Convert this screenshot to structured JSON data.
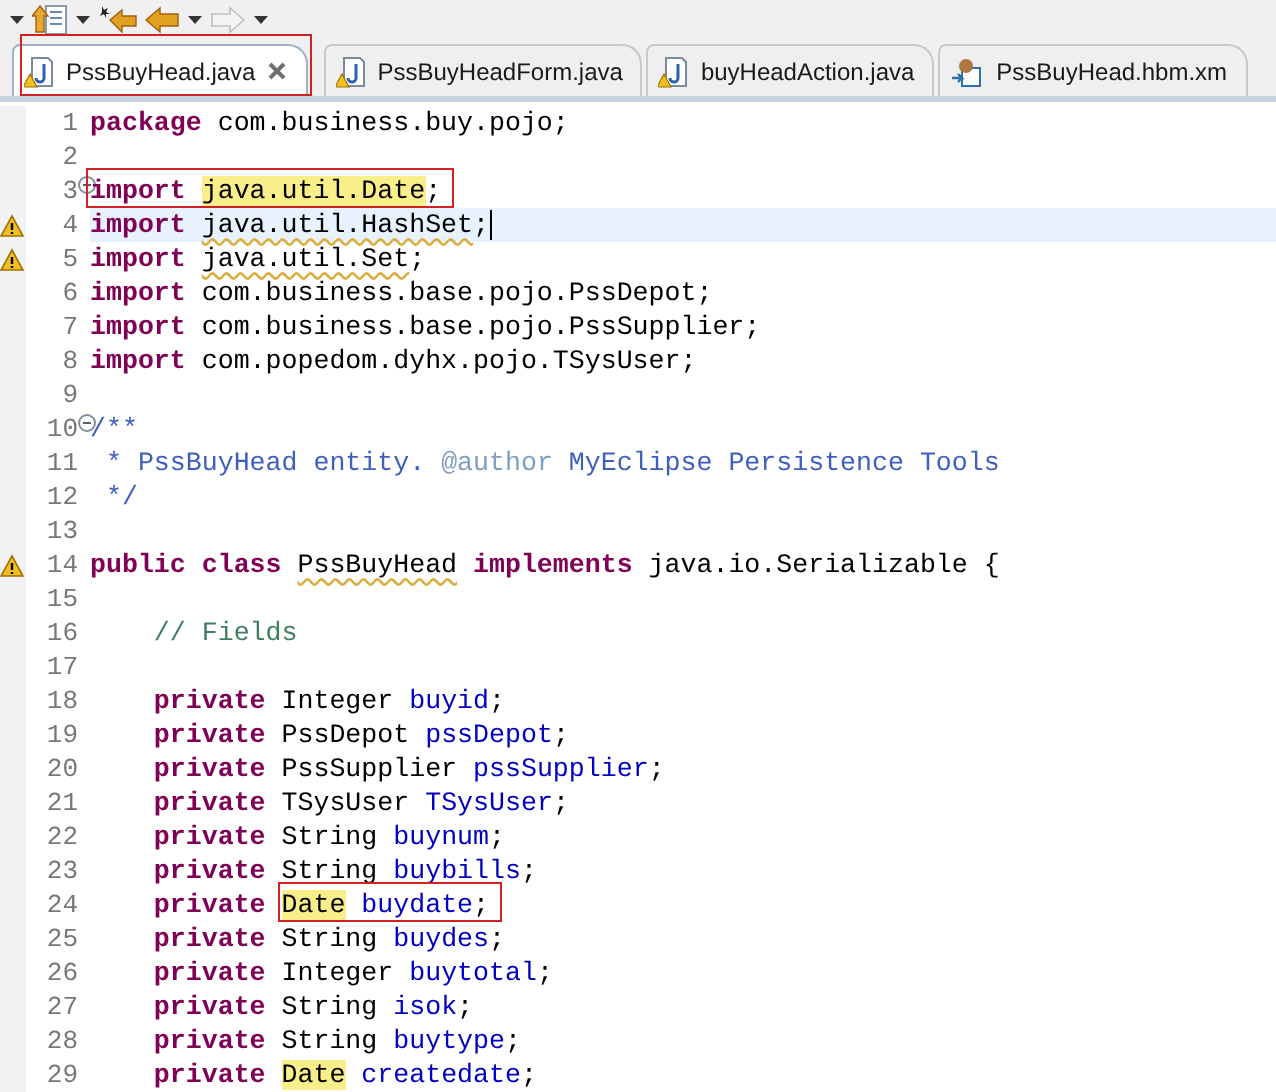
{
  "toolbar": [
    {
      "kind": "caret",
      "disabled": false
    },
    {
      "kind": "annotation",
      "disabled": false
    },
    {
      "kind": "caret",
      "disabled": false
    },
    {
      "kind": "last-edit",
      "disabled": false
    },
    {
      "kind": "back",
      "disabled": false
    },
    {
      "kind": "caret",
      "disabled": false
    },
    {
      "kind": "forward",
      "disabled": true
    },
    {
      "kind": "caret",
      "disabled": false
    }
  ],
  "tabs": [
    {
      "label": "PssBuyHead.java",
      "selected": true,
      "kind": "java",
      "warning": true,
      "closable": true,
      "boxed": true
    },
    {
      "label": "PssBuyHeadForm.java",
      "selected": false,
      "kind": "java",
      "warning": true
    },
    {
      "label": "buyHeadAction.java",
      "selected": false,
      "kind": "java",
      "warning": true
    },
    {
      "label": "PssBuyHead.hbm.xm",
      "selected": false,
      "kind": "mapping"
    }
  ],
  "lines": [
    {
      "number": "1",
      "tokens": [
        {
          "text": "package ",
          "kind": "keyword"
        },
        {
          "text": "com.business.buy.pojo;",
          "kind": "plain"
        }
      ]
    },
    {
      "number": "2"
    },
    {
      "number": "3",
      "fold": true,
      "tokens": [
        {
          "text": "import ",
          "kind": "keyword",
          "boxed": true
        },
        {
          "text": "java.util.Date",
          "kind": "plain",
          "highlight": true,
          "boxed": true
        },
        {
          "text": ";",
          "kind": "plain",
          "boxed": true
        }
      ]
    },
    {
      "number": "4",
      "warning": true,
      "current": true,
      "tokens": [
        {
          "text": "import ",
          "kind": "keyword"
        },
        {
          "text": "java.util.HashSet",
          "kind": "plain",
          "squiggle": true
        },
        {
          "text": ";",
          "kind": "plain"
        }
      ]
    },
    {
      "number": "5",
      "warning": true,
      "tokens": [
        {
          "text": "import ",
          "kind": "keyword"
        },
        {
          "text": "java.util.Set",
          "kind": "plain",
          "squiggle": true
        },
        {
          "text": ";",
          "kind": "plain"
        }
      ]
    },
    {
      "number": "6",
      "tokens": [
        {
          "text": "import ",
          "kind": "keyword"
        },
        {
          "text": "com.business.base.pojo.PssDepot;",
          "kind": "plain"
        }
      ]
    },
    {
      "number": "7",
      "tokens": [
        {
          "text": "import ",
          "kind": "keyword"
        },
        {
          "text": "com.business.base.pojo.PssSupplier;",
          "kind": "plain"
        }
      ]
    },
    {
      "number": "8",
      "tokens": [
        {
          "text": "import ",
          "kind": "keyword"
        },
        {
          "text": "com.popedom.dyhx.pojo.TSysUser;",
          "kind": "plain"
        }
      ]
    },
    {
      "number": "9"
    },
    {
      "number": "10",
      "fold": true,
      "tokens": [
        {
          "text": "/**",
          "kind": "javadoc"
        }
      ]
    },
    {
      "number": "11",
      "tokens": [
        {
          "text": " * PssBuyHead entity. ",
          "kind": "javadoc"
        },
        {
          "text": "@author",
          "kind": "javadoc-tag"
        },
        {
          "text": " MyEclipse Persistence Tools",
          "kind": "javadoc"
        }
      ]
    },
    {
      "number": "12",
      "tokens": [
        {
          "text": " */",
          "kind": "javadoc"
        }
      ]
    },
    {
      "number": "13"
    },
    {
      "number": "14",
      "warning": true,
      "tokens": [
        {
          "text": "public class ",
          "kind": "keyword"
        },
        {
          "text": "PssBuyHead",
          "kind": "plain",
          "squiggle": true
        },
        {
          "text": " implements ",
          "kind": "keyword"
        },
        {
          "text": "java.io.Serializable {",
          "kind": "plain"
        }
      ]
    },
    {
      "number": "15"
    },
    {
      "number": "16",
      "tokens": [
        {
          "text": "    // Fields",
          "kind": "comment"
        }
      ]
    },
    {
      "number": "17"
    },
    {
      "number": "18",
      "tokens": [
        {
          "text": "    private ",
          "kind": "keyword"
        },
        {
          "text": "Integer ",
          "kind": "plain"
        },
        {
          "text": "buyid",
          "kind": "field"
        },
        {
          "text": ";",
          "kind": "plain"
        }
      ]
    },
    {
      "number": "19",
      "tokens": [
        {
          "text": "    private ",
          "kind": "keyword"
        },
        {
          "text": "PssDepot ",
          "kind": "plain"
        },
        {
          "text": "pssDepot",
          "kind": "field"
        },
        {
          "text": ";",
          "kind": "plain"
        }
      ]
    },
    {
      "number": "20",
      "tokens": [
        {
          "text": "    private ",
          "kind": "keyword"
        },
        {
          "text": "PssSupplier ",
          "kind": "plain"
        },
        {
          "text": "pssSupplier",
          "kind": "field"
        },
        {
          "text": ";",
          "kind": "plain"
        }
      ]
    },
    {
      "number": "21",
      "tokens": [
        {
          "text": "    private ",
          "kind": "keyword"
        },
        {
          "text": "TSysUser ",
          "kind": "plain"
        },
        {
          "text": "TSysUser",
          "kind": "field"
        },
        {
          "text": ";",
          "kind": "plain"
        }
      ]
    },
    {
      "number": "22",
      "tokens": [
        {
          "text": "    private ",
          "kind": "keyword"
        },
        {
          "text": "String ",
          "kind": "plain"
        },
        {
          "text": "buynum",
          "kind": "field"
        },
        {
          "text": ";",
          "kind": "plain"
        }
      ]
    },
    {
      "number": "23",
      "tokens": [
        {
          "text": "    private ",
          "kind": "keyword"
        },
        {
          "text": "String ",
          "kind": "plain"
        },
        {
          "text": "buybills",
          "kind": "field"
        },
        {
          "text": ";",
          "kind": "plain"
        }
      ]
    },
    {
      "number": "24",
      "tokens": [
        {
          "text": "    private ",
          "kind": "keyword"
        },
        {
          "text": "Date",
          "kind": "plain",
          "highlight": true,
          "boxed": true
        },
        {
          "text": " buydate",
          "kind": "field",
          "boxed": true
        },
        {
          "text": ";",
          "kind": "plain",
          "boxed": true
        }
      ]
    },
    {
      "number": "25",
      "tokens": [
        {
          "text": "    private ",
          "kind": "keyword"
        },
        {
          "text": "String ",
          "kind": "plain"
        },
        {
          "text": "buydes",
          "kind": "field"
        },
        {
          "text": ";",
          "kind": "plain"
        }
      ]
    },
    {
      "number": "26",
      "tokens": [
        {
          "text": "    private ",
          "kind": "keyword"
        },
        {
          "text": "Integer ",
          "kind": "plain"
        },
        {
          "text": "buytotal",
          "kind": "field"
        },
        {
          "text": ";",
          "kind": "plain"
        }
      ]
    },
    {
      "number": "27",
      "tokens": [
        {
          "text": "    private ",
          "kind": "keyword"
        },
        {
          "text": "String ",
          "kind": "plain"
        },
        {
          "text": "isok",
          "kind": "field"
        },
        {
          "text": ";",
          "kind": "plain"
        }
      ]
    },
    {
      "number": "28",
      "tokens": [
        {
          "text": "    private ",
          "kind": "keyword"
        },
        {
          "text": "String ",
          "kind": "plain"
        },
        {
          "text": "buytype",
          "kind": "field"
        },
        {
          "text": ";",
          "kind": "plain"
        }
      ]
    },
    {
      "number": "29",
      "tokens": [
        {
          "text": "    private ",
          "kind": "keyword"
        },
        {
          "text": "Date",
          "kind": "plain",
          "highlight": true
        },
        {
          "text": " createdate",
          "kind": "field"
        },
        {
          "text": ";",
          "kind": "plain"
        }
      ]
    }
  ]
}
